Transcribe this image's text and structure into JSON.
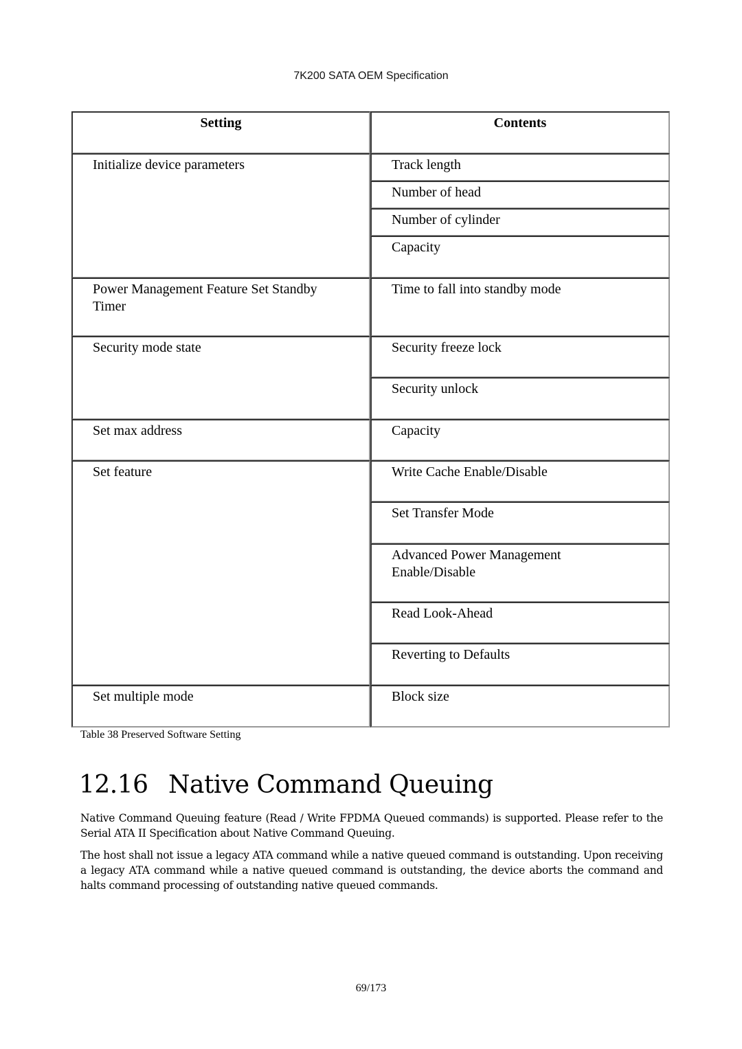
{
  "header": {
    "title": "7K200 SATA OEM Specification"
  },
  "table": {
    "headers": [
      "Setting",
      "Contents"
    ],
    "rows": [
      {
        "setting": "Initialize device parameters",
        "contents": [
          "Track length",
          "Number of head",
          "Number of cylinder",
          "Capacity"
        ]
      },
      {
        "setting": "Power Management Feature Set Standby Timer",
        "contents": [
          "Time to fall into standby mode"
        ]
      },
      {
        "setting": "Security mode state",
        "contents": [
          "Security freeze lock",
          "Security unlock"
        ]
      },
      {
        "setting": "Set max address",
        "contents": [
          "Capacity"
        ]
      },
      {
        "setting": "Set feature",
        "contents": [
          "Write Cache Enable/Disable",
          "Set Transfer Mode",
          "Advanced Power Management Enable/Disable",
          "Read Look-Ahead",
          "Reverting to Defaults"
        ]
      },
      {
        "setting": "Set multiple mode",
        "contents": [
          "Block size"
        ]
      }
    ],
    "caption": "Table 38 Preserved Software Setting"
  },
  "section": {
    "number": "12.16",
    "title": "Native Command Queuing",
    "paragraphs": [
      "Native Command Queuing feature (Read / Write FPDMA Queued commands) is supported.   Please refer to the Serial ATA II Specification about Native Command Queuing.",
      "The host shall not issue a legacy ATA command while a native queued command is outstanding. Upon receiving a legacy ATA command while a native queued command is outstanding, the device aborts the command and halts command processing of outstanding native queued commands."
    ]
  },
  "footer": {
    "page": "69/173"
  }
}
